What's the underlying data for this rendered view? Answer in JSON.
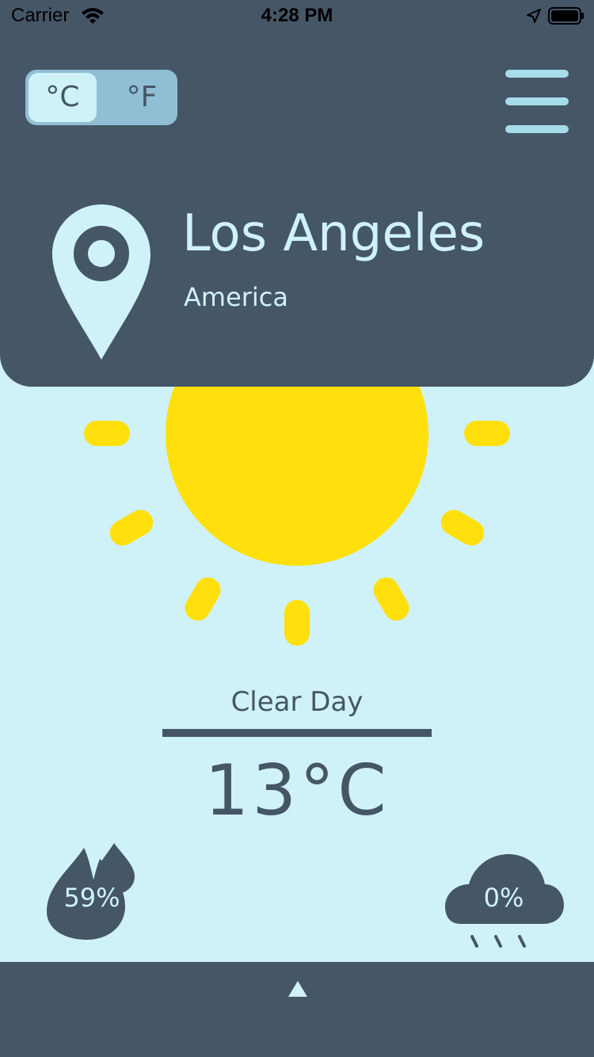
{
  "status_bar": {
    "carrier": "Carrier",
    "time": "4:28 PM"
  },
  "units": {
    "celsius_label": "°C",
    "fahrenheit_label": "°F",
    "selected": "°C"
  },
  "location": {
    "city": "Los Angeles",
    "country": "America"
  },
  "weather": {
    "condition": "Clear Day",
    "temperature": "13°C",
    "humidity": "59%",
    "precipitation": "0%"
  },
  "icons": {
    "status": [
      "wifi-icon",
      "location-arrow-icon",
      "battery-icon"
    ],
    "menu": "menu-icon",
    "location": "location-pin-icon",
    "weather": "sun-icon",
    "humidity": "humidity-drop-icon",
    "precipitation": "rain-cloud-icon",
    "bottom": "expand-up-icon"
  },
  "colors": {
    "header_background": "#455666",
    "page_background": "#cff2f9",
    "accent_blue": "#a7dcea",
    "sun_yellow": "#ffe00c",
    "text_dark": "#455666"
  }
}
